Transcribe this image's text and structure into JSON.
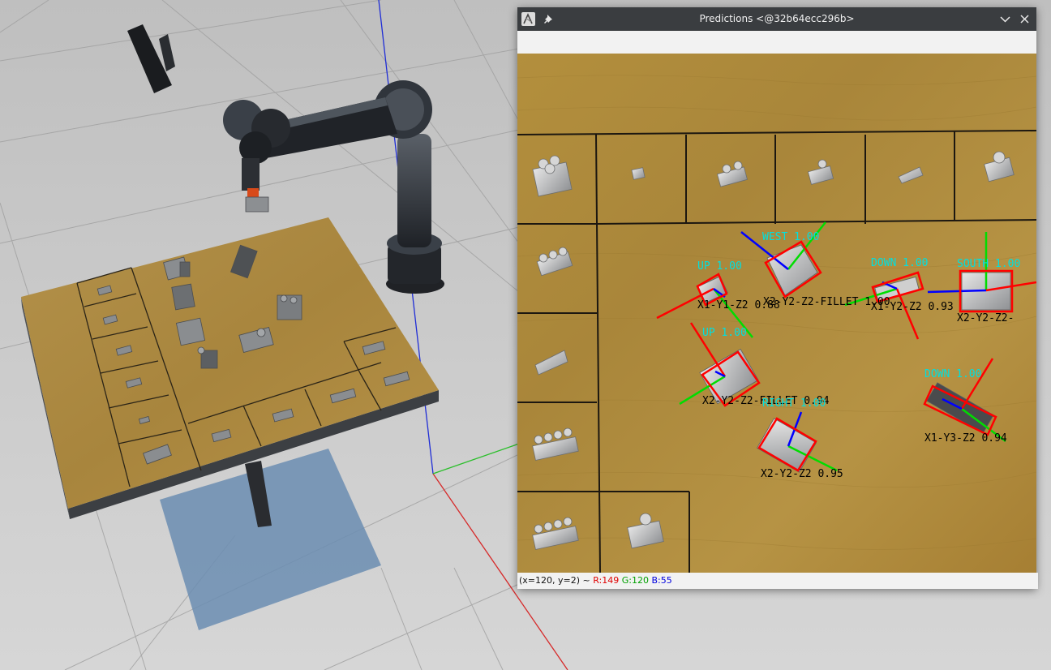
{
  "window": {
    "title": "Predictions <@32b64ecc296b>",
    "icons": [
      "app-icon",
      "pin-icon",
      "minimize-chevron-icon",
      "close-icon"
    ]
  },
  "status": {
    "coords": "(x=120, y=2) ~ ",
    "r": "R:149",
    "g": "G:120",
    "b": "B:55"
  },
  "predictions": [
    {
      "orientation": "WEST 1.00",
      "class": "X2-Y2-Z2-FILLET 1.00"
    },
    {
      "orientation": "UP 1.00",
      "class": "X1-Y1-Z2 0.88"
    },
    {
      "orientation": "DOWN 1.00",
      "class": "X1-Y2-Z2 0.93"
    },
    {
      "orientation": "SOUTH 1.00",
      "class": "X2-Y2-Z2-"
    },
    {
      "orientation": "UP 1.00",
      "class": "X2-Y2-Z2-FILLET 0.94"
    },
    {
      "orientation": "RIGHT 1.00",
      "class": "X2-Y2-Z2 0.95"
    },
    {
      "orientation": "DOWN 1.00",
      "class": "X1-Y3-Z2 0.94"
    }
  ],
  "colors": {
    "label_orientation": "#00e0e0",
    "label_class": "#000000",
    "bbox": "#ff0000",
    "axis_x": "#ff0000",
    "axis_y": "#00dd00",
    "axis_z": "#0000ff",
    "table_wood": "#b28d3c",
    "floor": "#cfcfcf"
  }
}
